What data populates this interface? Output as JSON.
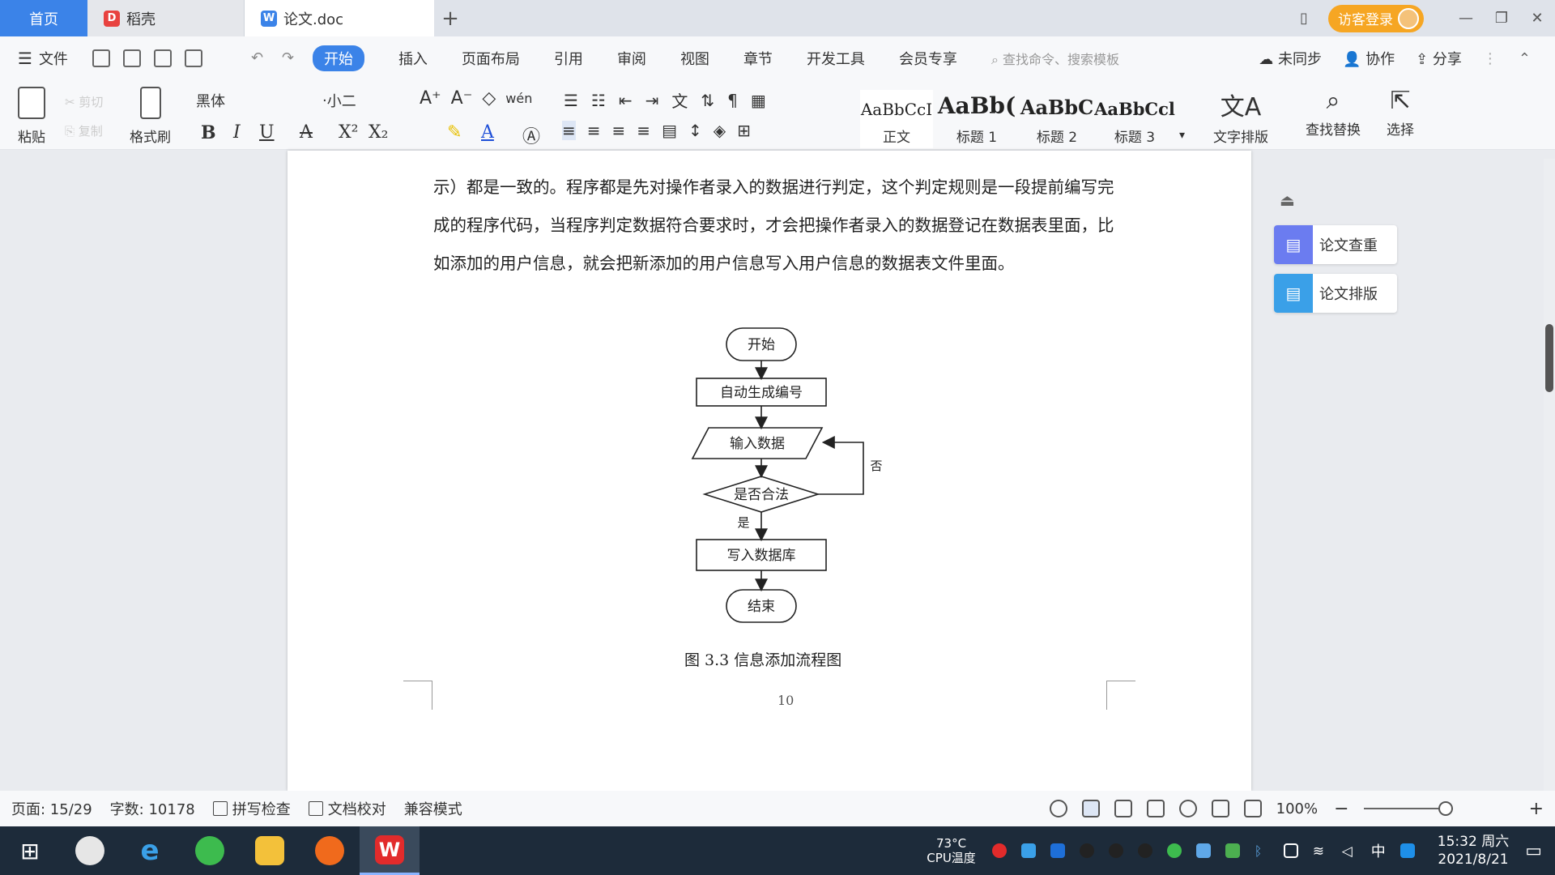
{
  "titlebar": {
    "tabs": [
      {
        "label": "首页"
      },
      {
        "label": "稻壳"
      },
      {
        "label": "论文.doc"
      }
    ],
    "login_label": "访客登录"
  },
  "menubar": {
    "file_label": "文件",
    "items": [
      "开始",
      "插入",
      "页面布局",
      "引用",
      "审阅",
      "视图",
      "章节",
      "开发工具",
      "会员专享"
    ],
    "active_index": 0,
    "search_hint": "查找命令、搜索模板",
    "sync_label": "未同步",
    "collab_label": "协作",
    "share_label": "分享"
  },
  "ribbon": {
    "paste_label": "粘贴",
    "format_painter_label": "格式刷",
    "font_name": "黑体",
    "font_size": "小二",
    "styles": [
      {
        "sample": "AaBbCcI",
        "label": "正文"
      },
      {
        "sample": "AaBb(",
        "label": "标题 1"
      },
      {
        "sample": "AaBbC",
        "label": "标题 2"
      },
      {
        "sample": "AaBbCcl",
        "label": "标题 3"
      }
    ],
    "text_layout_label": "文字排版",
    "find_replace_label": "查找替换",
    "select_label": "选择"
  },
  "document": {
    "paragraph": "示）都是一致的。程序都是先对操作者录入的数据进行判定，这个判定规则是一段提前编写完成的程序代码，当程序判定数据符合要求时，才会把操作者录入的数据登记在数据表里面，比如添加的用户信息，就会把新添加的用户信息写入用户信息的数据表文件里面。",
    "flowchart": {
      "start": "开始",
      "step1": "自动生成编号",
      "step2": "输入数据",
      "decision": "是否合法",
      "yes": "是",
      "no": "否",
      "step3": "写入数据库",
      "end": "结束"
    },
    "caption": "图 3.3  信息添加流程图",
    "page_number": "10"
  },
  "side_panel": {
    "items": [
      {
        "label": "论文查重",
        "color": "#6b7cf0"
      },
      {
        "label": "论文排版",
        "color": "#3aa0e8"
      }
    ]
  },
  "statusbar": {
    "page": "页面: 15/29",
    "words": "字数: 10178",
    "spell_check": "拼写检查",
    "doc_proof": "文档校对",
    "compat_mode": "兼容模式",
    "zoom": "100%"
  },
  "taskbar": {
    "temp_value": "73°C",
    "temp_label": "CPU温度",
    "ime": "中",
    "time": "15:32 周六",
    "date": "2021/8/21"
  }
}
